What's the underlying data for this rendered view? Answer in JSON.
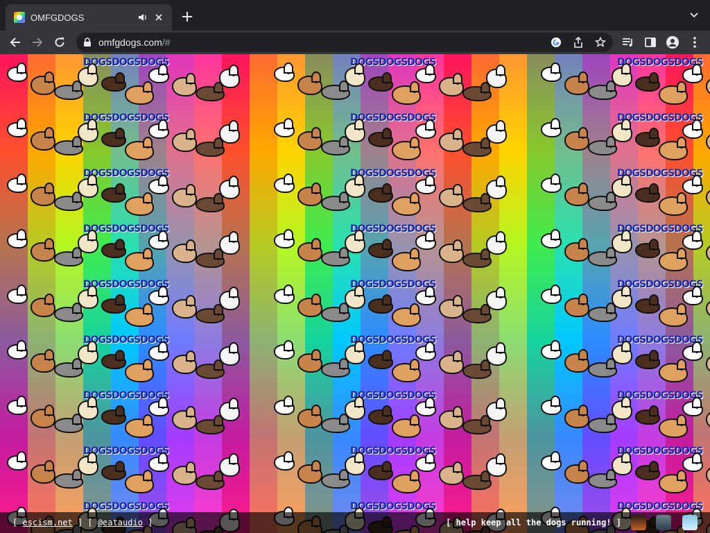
{
  "browser": {
    "tab": {
      "title": "OMFGDOGS"
    },
    "url": {
      "domain": "omfgdogs.com",
      "rest": "/#"
    }
  },
  "page": {
    "footer": {
      "bracket_open": "[",
      "bracket_close": "]",
      "link1": "escism.net",
      "link2": "@eataudio",
      "cta": "[ help keep all the dogs running! ]"
    },
    "pattern_text": "DOGSDOGSDOGS"
  },
  "colors": {
    "toolbar": "#35363a",
    "tabbar": "#202124",
    "omnibox": "#202124"
  }
}
